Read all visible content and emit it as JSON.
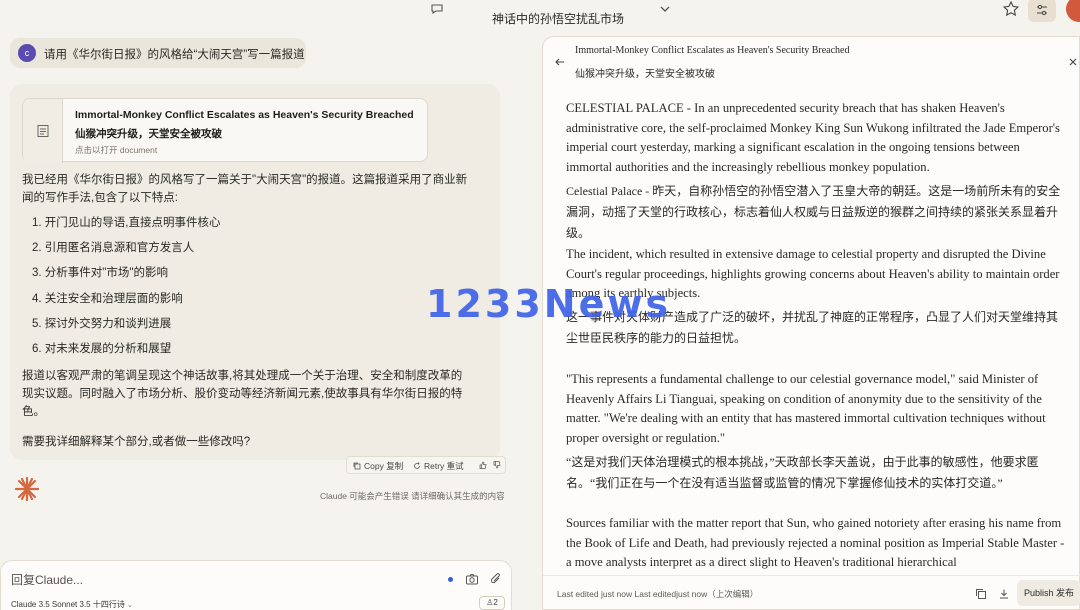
{
  "header": {
    "conversation_title": "神话中的孙悟空扰乱市场"
  },
  "user_message": {
    "avatar_initial": "c",
    "text": "请用《华尔街日报》的风格给“大闹天宫”写一篇报道"
  },
  "assistant_message": {
    "document_card": {
      "title_en": "Immortal-Monkey Conflict Escalates as Heaven's Security Breached",
      "title_zh": "仙猴冲突升级，天堂安全被攻破",
      "hint": "点击以打开 document"
    },
    "intro": "我已经用《华尔街日报》的风格写了一篇关于\"大闹天宫\"的报道。这篇报道采用了商业新闻的写作手法,包含了以下特点:",
    "features": [
      "1. 开门见山的导语,直接点明事件核心",
      "2. 引用匿名消息源和官方发言人",
      "3. 分析事件对\"市场\"的影响",
      "4. 关注安全和治理层面的影响",
      "5. 探讨外交努力和谈判进展",
      "6. 对未来发展的分析和展望"
    ],
    "summary": "报道以客观严肃的笔调呈现这个神话故事,将其处理成一个关于治理、安全和制度改革的现实议题。同时融入了市场分析、股价变动等经济新闻元素,使故事具有华尔街日报的特色。",
    "closing": "需要我详细解释某个部分,或者做一些修改吗?",
    "actions": {
      "copy_label": "Copy 复制",
      "retry_label": "Retry 重试"
    }
  },
  "disclaimer": "Claude 可能会产生错误 请详细确认其生成的内容",
  "composer": {
    "placeholder": "回复Claude...",
    "model_label": "Claude 3.5 Sonnet 3.5 十四行诗",
    "style_count": "2"
  },
  "document_panel": {
    "title_en": "Immortal-Monkey Conflict Escalates as Heaven's Security Breached",
    "title_zh": "仙猴冲突升级，天堂安全被攻破",
    "paragraphs": [
      {
        "en": "CELESTIAL PALACE - In an unprecedented security breach that has shaken Heaven's administrative core, the self-proclaimed Monkey King Sun Wukong infiltrated the Jade Emperor's imperial court yesterday, marking a significant escalation in the ongoing tensions between immortal authorities and the increasingly rebellious monkey population.",
        "zh": "Celestial Palace - 昨天，自称孙悟空的孙悟空潜入了玉皇大帝的朝廷。这是一场前所未有的安全漏洞，动摇了天堂的行政核心，标志着仙人权威与日益叛逆的猴群之间持续的紧张关系显着升级。"
      },
      {
        "en": "The incident, which resulted in extensive damage to celestial property and disrupted the Divine Court's regular proceedings, highlights growing concerns about Heaven's ability to maintain order among its earthly subjects.",
        "zh": "这一事件对天体财产造成了广泛的破坏，并扰乱了神庭的正常程序，凸显了人们对天堂维持其尘世臣民秩序的能力的日益担忧。"
      },
      {
        "en": "\"This represents a fundamental challenge to our celestial governance model,\" said Minister of Heavenly Affairs Li Tianguai, speaking on condition of anonymity due to the sensitivity of the matter. \"We're dealing with an entity that has mastered immortal cultivation techniques without proper oversight or regulation.\"",
        "zh": "“这是对我们天体治理模式的根本挑战，”天政部长李天盖说，由于此事的敏感性，他要求匿名。“我们正在与一个在没有适当监督或监管的情况下掌握修仙技术的实体打交道。”"
      },
      {
        "en": "Sources familiar with the matter report that Sun, who gained notoriety after erasing his name from the Book of Life and Death, had previously rejected a nominal position as Imperial Stable Master - a move analysts interpret as a direct slight to Heaven's traditional hierarchical"
      }
    ],
    "footer": {
      "status": "Last edited just now Last editedjust now（上次编辑）",
      "publish_label": "Publish 发布"
    }
  },
  "watermark": "1233News"
}
